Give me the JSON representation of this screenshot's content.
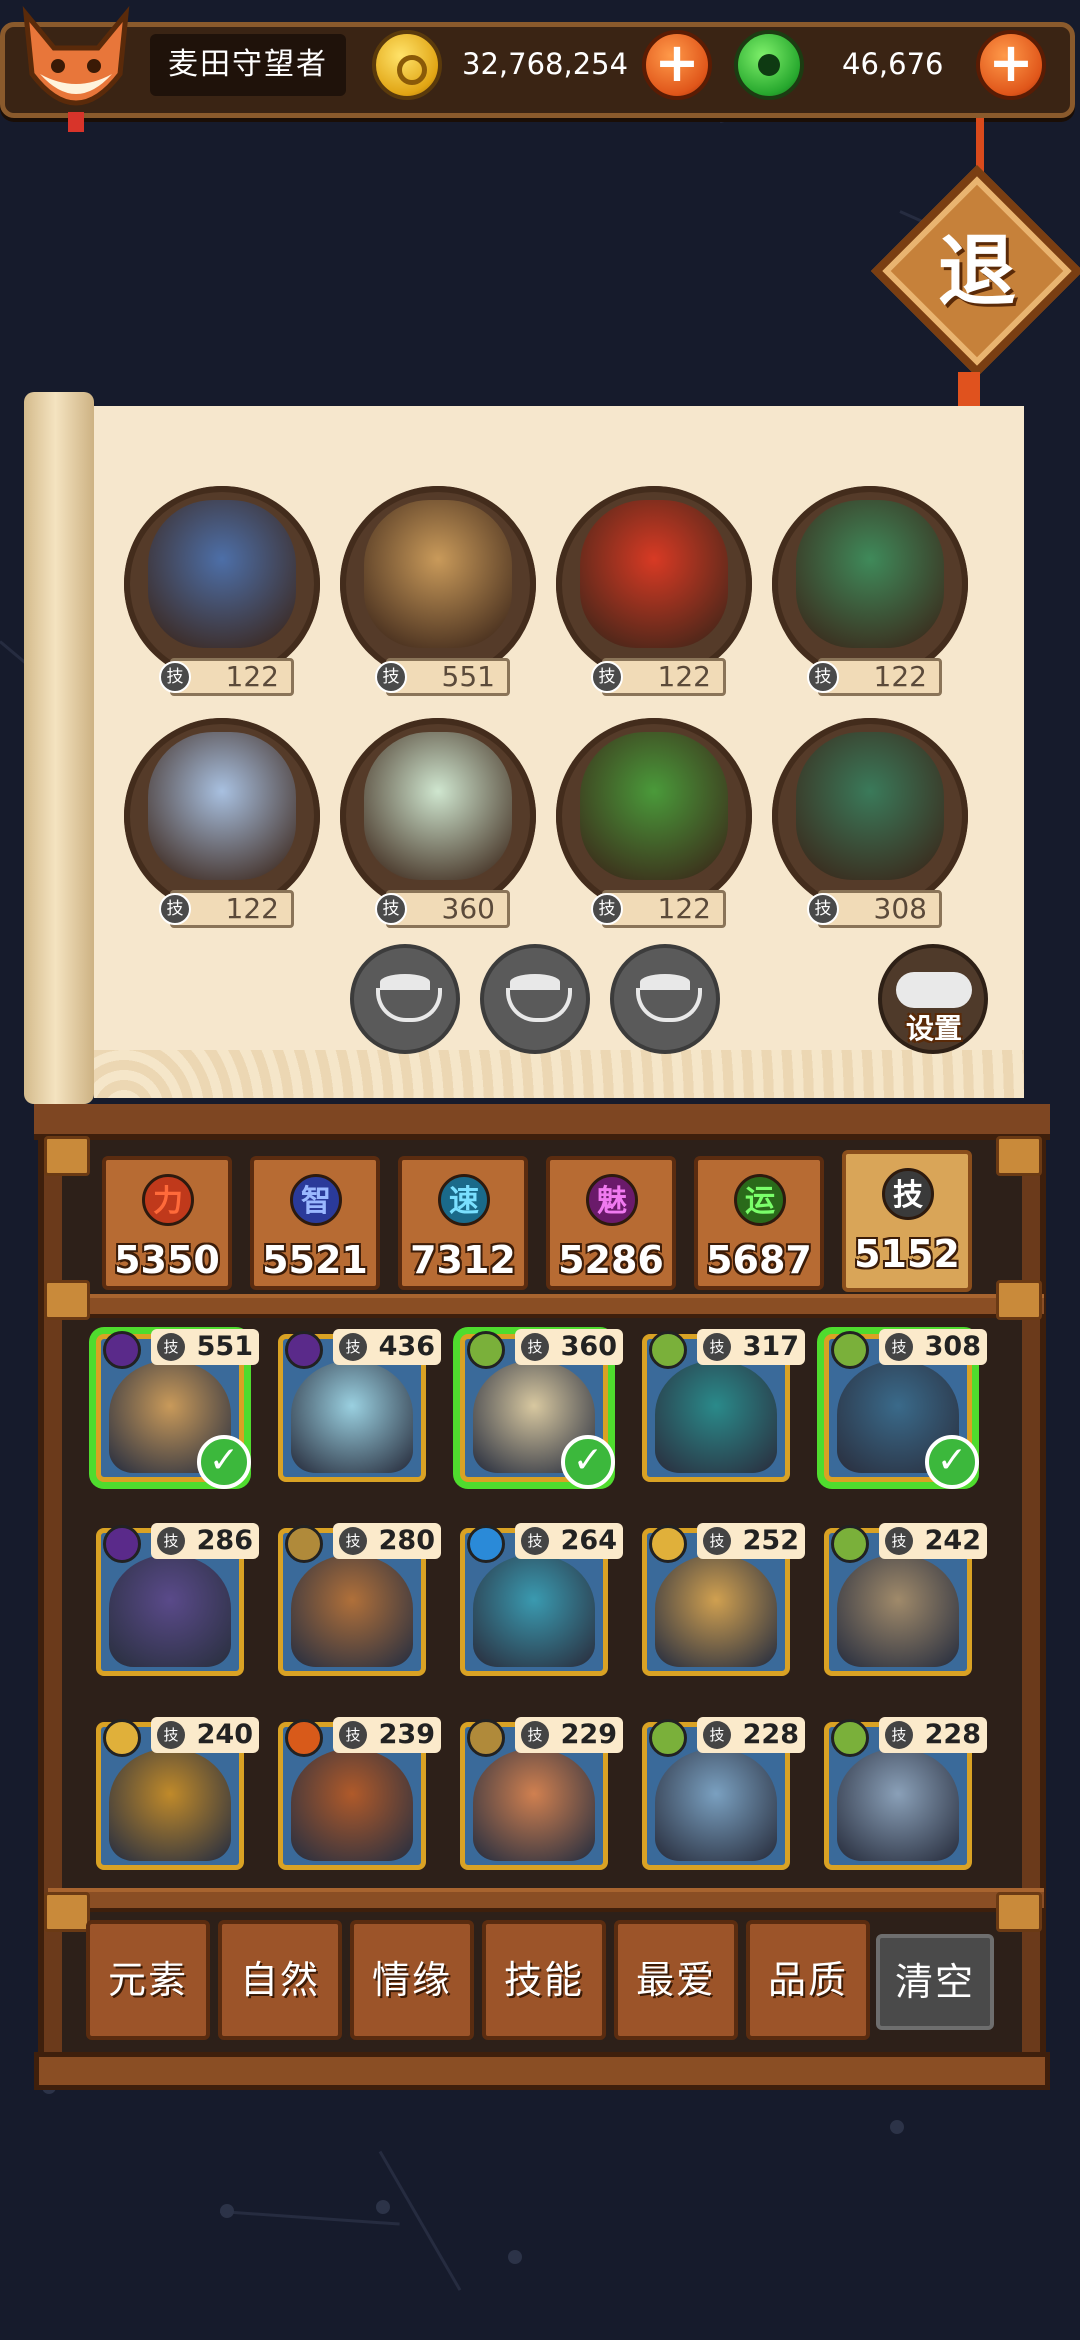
{
  "player": {
    "name": "麦田守望者"
  },
  "currency": {
    "gold": "32,768,254",
    "jade": "46,676"
  },
  "exit_label": "退",
  "settings_label": "设置",
  "lineup": [
    {
      "level": "122",
      "color": "#4d6fa8"
    },
    {
      "level": "551",
      "color": "#c99a5a"
    },
    {
      "level": "122",
      "color": "#d83a24"
    },
    {
      "level": "122",
      "color": "#3f8a5a"
    },
    {
      "level": "122",
      "color": "#a8c0e0"
    },
    {
      "level": "360",
      "color": "#cfe6cf"
    },
    {
      "level": "122",
      "color": "#4a9a3a"
    },
    {
      "level": "308",
      "color": "#3a7a5a"
    }
  ],
  "bowls": 3,
  "stats": [
    {
      "label": "力",
      "value": "5350",
      "color": "#c0391b",
      "text": "#ff6a3a"
    },
    {
      "label": "智",
      "value": "5521",
      "color": "#2a3a9a",
      "text": "#9ab8ff"
    },
    {
      "label": "速",
      "value": "7312",
      "color": "#1a6a8a",
      "text": "#7ae0ff"
    },
    {
      "label": "魅",
      "value": "5286",
      "color": "#6a1a6a",
      "text": "#f07af0"
    },
    {
      "label": "运",
      "value": "5687",
      "color": "#2a6a1a",
      "text": "#7aff6a"
    },
    {
      "label": "技",
      "value": "5152",
      "color": "#3a3a3a",
      "text": "#ffffff"
    }
  ],
  "skill_badge": "技",
  "heroes": [
    {
      "level": "551",
      "element": "#5a2a8a",
      "color": "#c99a5a",
      "selected": true
    },
    {
      "level": "436",
      "element": "#5a2a8a",
      "color": "#9ad0e0",
      "selected": false
    },
    {
      "level": "360",
      "element": "#7ab03a",
      "color": "#d8c8a0",
      "selected": true
    },
    {
      "level": "317",
      "element": "#7ab03a",
      "color": "#2a8a8a",
      "selected": false
    },
    {
      "level": "308",
      "element": "#7ab03a",
      "color": "#3a6a8a",
      "selected": true
    },
    {
      "level": "286",
      "element": "#5a2a8a",
      "color": "#5a4a8a",
      "selected": false
    },
    {
      "level": "280",
      "element": "#b08a3a",
      "color": "#b0703a",
      "selected": false
    },
    {
      "level": "264",
      "element": "#2a8ad8",
      "color": "#3a9ab0",
      "selected": false
    },
    {
      "level": "252",
      "element": "#e0b03a",
      "color": "#d0a050",
      "selected": false
    },
    {
      "level": "242",
      "element": "#7ab03a",
      "color": "#a08a6a",
      "selected": false
    },
    {
      "level": "240",
      "element": "#e0b03a",
      "color": "#c08a2a",
      "selected": false
    },
    {
      "level": "239",
      "element": "#d85a1a",
      "color": "#b05a2a",
      "selected": false
    },
    {
      "level": "229",
      "element": "#b08a3a",
      "color": "#d08050",
      "selected": false
    },
    {
      "level": "228",
      "element": "#7ab03a",
      "color": "#7aa0c0",
      "selected": false
    },
    {
      "level": "228",
      "element": "#7ab03a",
      "color": "#8aa0b8",
      "selected": false
    }
  ],
  "filters": [
    "元素",
    "自然",
    "情缘",
    "技能",
    "最爱",
    "品质"
  ],
  "clear_label": "清空"
}
